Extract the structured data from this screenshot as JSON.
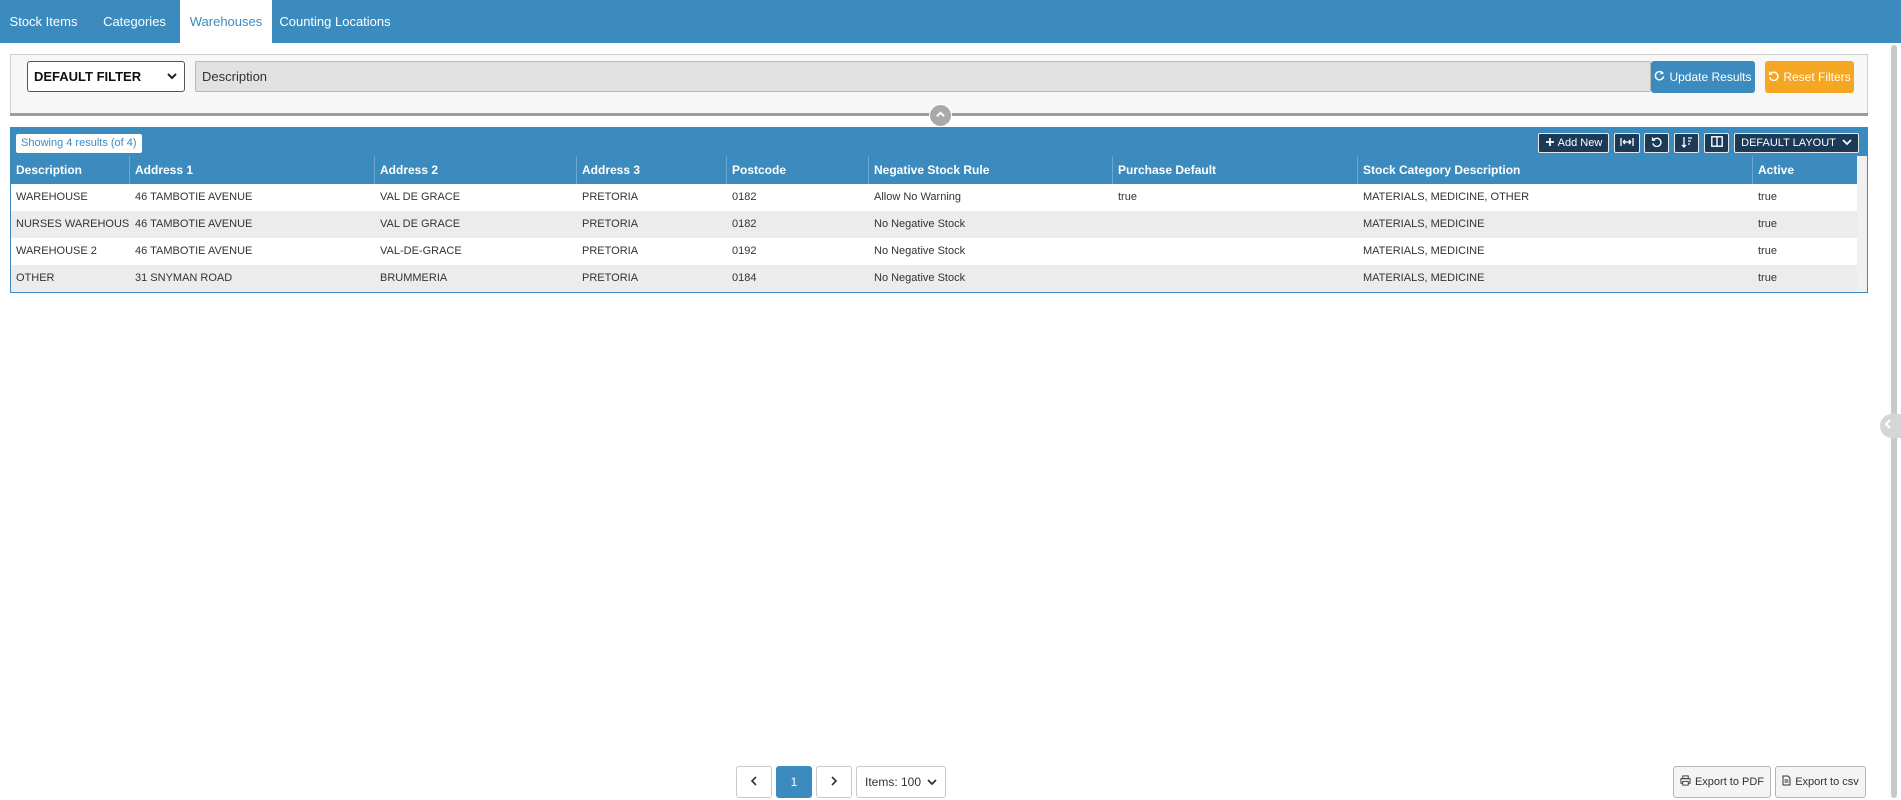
{
  "tabs": [
    {
      "label": "Stock Items",
      "active": false
    },
    {
      "label": "Categories",
      "active": false
    },
    {
      "label": "Warehouses",
      "active": true
    },
    {
      "label": "Counting Locations",
      "active": false
    }
  ],
  "filter": {
    "select_value": "DEFAULT FILTER",
    "description_placeholder": "Description",
    "update_label": "Update Results",
    "reset_label": "Reset Filters"
  },
  "grid": {
    "results_text": "Showing 4 results (of 4)",
    "add_new_label": "Add New",
    "layout_label": "DEFAULT LAYOUT",
    "columns": [
      "Description",
      "Address 1",
      "Address 2",
      "Address 3",
      "Postcode",
      "Negative Stock Rule",
      "Purchase Default",
      "Stock Category Description",
      "Active"
    ],
    "rows": [
      [
        "WAREHOUSE",
        "46 TAMBOTIE AVENUE",
        "VAL DE GRACE",
        "PRETORIA",
        "0182",
        "Allow No Warning",
        "true",
        "MATERIALS, MEDICINE, OTHER",
        "true"
      ],
      [
        "NURSES WAREHOUSE",
        "46 TAMBOTIE AVENUE",
        "VAL DE GRACE",
        "PRETORIA",
        "0182",
        "No Negative Stock",
        "",
        "MATERIALS, MEDICINE",
        "true"
      ],
      [
        "WAREHOUSE 2",
        "46 TAMBOTIE AVENUE",
        "VAL-DE-GRACE",
        "PRETORIA",
        "0192",
        "No Negative Stock",
        "",
        "MATERIALS, MEDICINE",
        "true"
      ],
      [
        "OTHER",
        "31 SNYMAN ROAD",
        "BRUMMERIA",
        "PRETORIA",
        "0184",
        "No Negative Stock",
        "",
        "MATERIALS, MEDICINE",
        "true"
      ]
    ]
  },
  "pagination": {
    "current_page": "1",
    "items_label": "Items: 100"
  },
  "export": {
    "pdf_label": "Export to PDF",
    "csv_label": "Export to csv"
  },
  "colors": {
    "primary": "#3b8bbf",
    "warning": "#f5a623",
    "dark_button": "#1b3a57"
  }
}
